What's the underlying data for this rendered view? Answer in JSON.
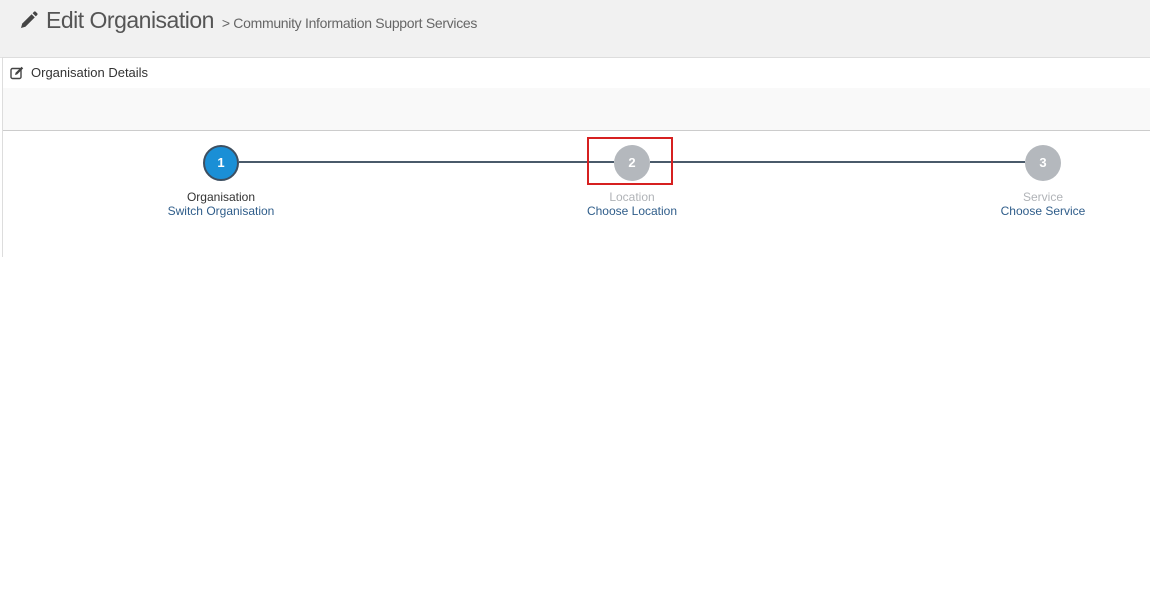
{
  "header": {
    "title": "Edit Organisation",
    "subtitle": "> Community Information Support Services",
    "icon": "pencil-icon"
  },
  "panel": {
    "heading": "Organisation Details",
    "heading_icon": "edit-icon"
  },
  "wizard": {
    "steps": [
      {
        "number": "1",
        "title": "Organisation",
        "link": "Switch Organisation",
        "state": "active"
      },
      {
        "number": "2",
        "title": "Location",
        "link": "Choose Location",
        "state": "inactive"
      },
      {
        "number": "3",
        "title": "Service",
        "link": "Choose Service",
        "state": "inactive"
      }
    ]
  },
  "colors": {
    "active_step": "#1a8fd6",
    "inactive_step": "#b4b8bd",
    "connector": "#4a5a6a",
    "link": "#2f5d8a",
    "highlight": "#d62020"
  }
}
